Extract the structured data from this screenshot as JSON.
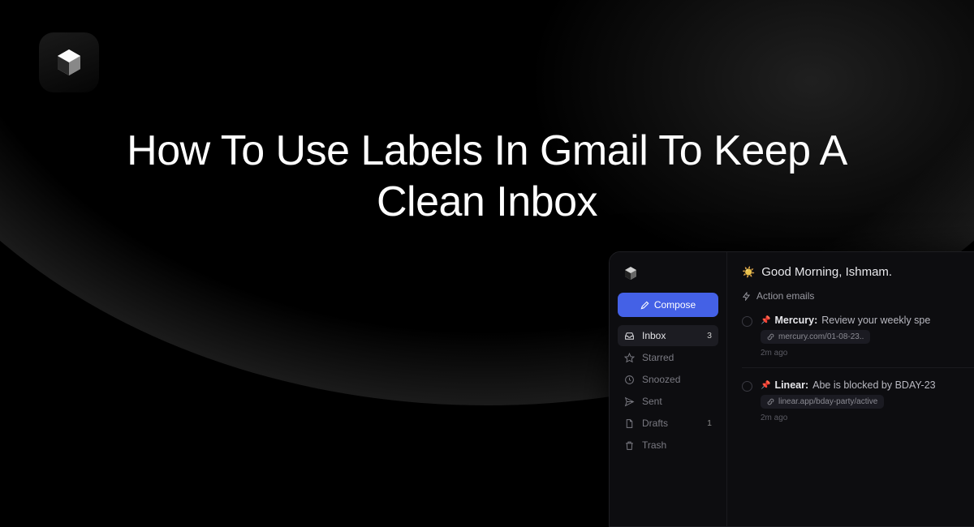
{
  "hero": {
    "title": "How To Use Labels In Gmail To Keep A Clean Inbox"
  },
  "app": {
    "compose_label": "Compose",
    "greeting": "Good Morning, Ishmam.",
    "section_header": "Action emails",
    "sidebar": {
      "items": [
        {
          "label": "Inbox",
          "count": "3"
        },
        {
          "label": "Starred",
          "count": ""
        },
        {
          "label": "Snoozed",
          "count": ""
        },
        {
          "label": "Sent",
          "count": ""
        },
        {
          "label": "Drafts",
          "count": "1"
        },
        {
          "label": "Trash",
          "count": ""
        }
      ]
    },
    "emails": [
      {
        "sender": "Mercury:",
        "subject": "Review your weekly spe",
        "chip": "mercury.com/01-08-23..",
        "time": "2m ago"
      },
      {
        "sender": "Linear:",
        "subject": "Abe is blocked by BDAY-23",
        "chip": "linear.app/bday-party/active",
        "time": "2m ago"
      }
    ]
  }
}
